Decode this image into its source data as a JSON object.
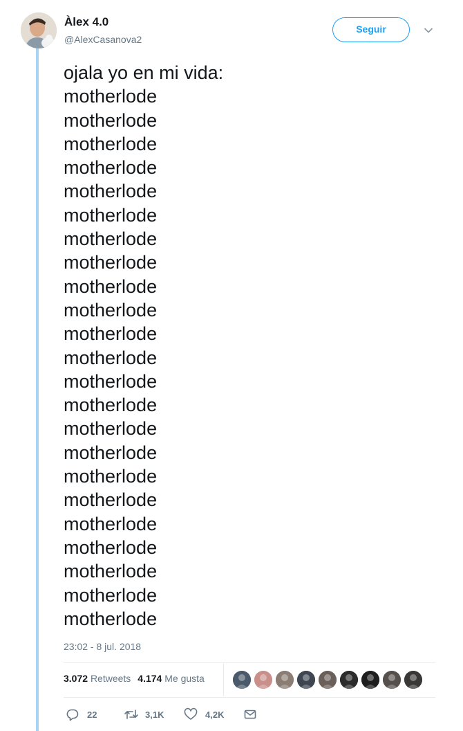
{
  "user": {
    "display_name": "Àlex 4.0",
    "handle": "@AlexCasanova2"
  },
  "follow_button": {
    "label": "Seguir"
  },
  "tweet": {
    "lines": [
      "ojala yo en mi vida:",
      "motherlode",
      "motherlode",
      "motherlode",
      "motherlode",
      "motherlode",
      "motherlode",
      "motherlode",
      "motherlode",
      "motherlode",
      "motherlode",
      "motherlode",
      "motherlode",
      "motherlode",
      "motherlode",
      "motherlode",
      "motherlode",
      "motherlode",
      "motherlode",
      "motherlode",
      "motherlode",
      "motherlode",
      "motherlode",
      "motherlode"
    ],
    "timestamp": "23:02 - 8 jul. 2018"
  },
  "stats": {
    "retweets_count": "3.072",
    "retweets_label": "Retweets",
    "likes_count": "4.174",
    "likes_label": "Me gusta"
  },
  "likers": [
    {
      "icon": "liker-avatar",
      "color": "#4a5a6a"
    },
    {
      "icon": "liker-avatar",
      "color": "#c98f8a"
    },
    {
      "icon": "liker-avatar",
      "color": "#8b7d74"
    },
    {
      "icon": "liker-avatar",
      "color": "#3f4652"
    },
    {
      "icon": "liker-avatar",
      "color": "#6b5f5a"
    },
    {
      "icon": "liker-avatar",
      "color": "#2b2b2b"
    },
    {
      "icon": "liker-avatar",
      "color": "#1e1e1e"
    },
    {
      "icon": "liker-avatar",
      "color": "#55504c"
    },
    {
      "icon": "liker-avatar",
      "color": "#3a3836"
    }
  ],
  "actions": {
    "replies": "22",
    "retweets": "3,1K",
    "likes": "4,2K"
  },
  "colors": {
    "accent": "#1da1f2",
    "thread_line": "#a6d4f2",
    "muted_text": "#657786"
  }
}
